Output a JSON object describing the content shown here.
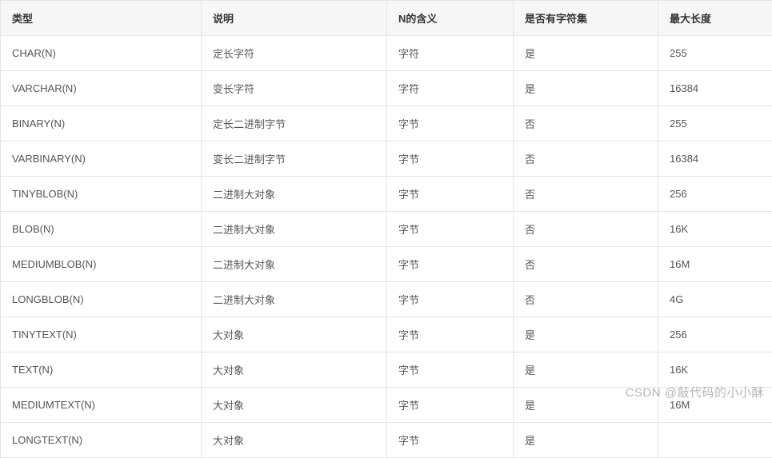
{
  "table": {
    "headers": [
      "类型",
      "说明",
      "N的含义",
      "是否有字符集",
      "最大长度"
    ],
    "rows": [
      [
        "CHAR(N)",
        "定长字符",
        "字符",
        "是",
        "255"
      ],
      [
        "VARCHAR(N)",
        "变长字符",
        "字符",
        "是",
        "16384"
      ],
      [
        "BINARY(N)",
        "定长二进制字节",
        "字节",
        "否",
        "255"
      ],
      [
        "VARBINARY(N)",
        "变长二进制字节",
        "字节",
        "否",
        "16384"
      ],
      [
        "TINYBLOB(N)",
        "二进制大对象",
        "字节",
        "否",
        "256"
      ],
      [
        "BLOB(N)",
        "二进制大对象",
        "字节",
        "否",
        "16K"
      ],
      [
        "MEDIUMBLOB(N)",
        "二进制大对象",
        "字节",
        "否",
        "16M"
      ],
      [
        "LONGBLOB(N)",
        "二进制大对象",
        "字节",
        "否",
        "4G"
      ],
      [
        "TINYTEXT(N)",
        "大对象",
        "字节",
        "是",
        "256"
      ],
      [
        "TEXT(N)",
        "大对象",
        "字节",
        "是",
        "16K"
      ],
      [
        "MEDIUMTEXT(N)",
        "大对象",
        "字节",
        "是",
        "16M"
      ],
      [
        "LONGTEXT(N)",
        "大对象",
        "字节",
        "是",
        ""
      ]
    ]
  },
  "watermark": "CSDN @敲代码的小小酥"
}
